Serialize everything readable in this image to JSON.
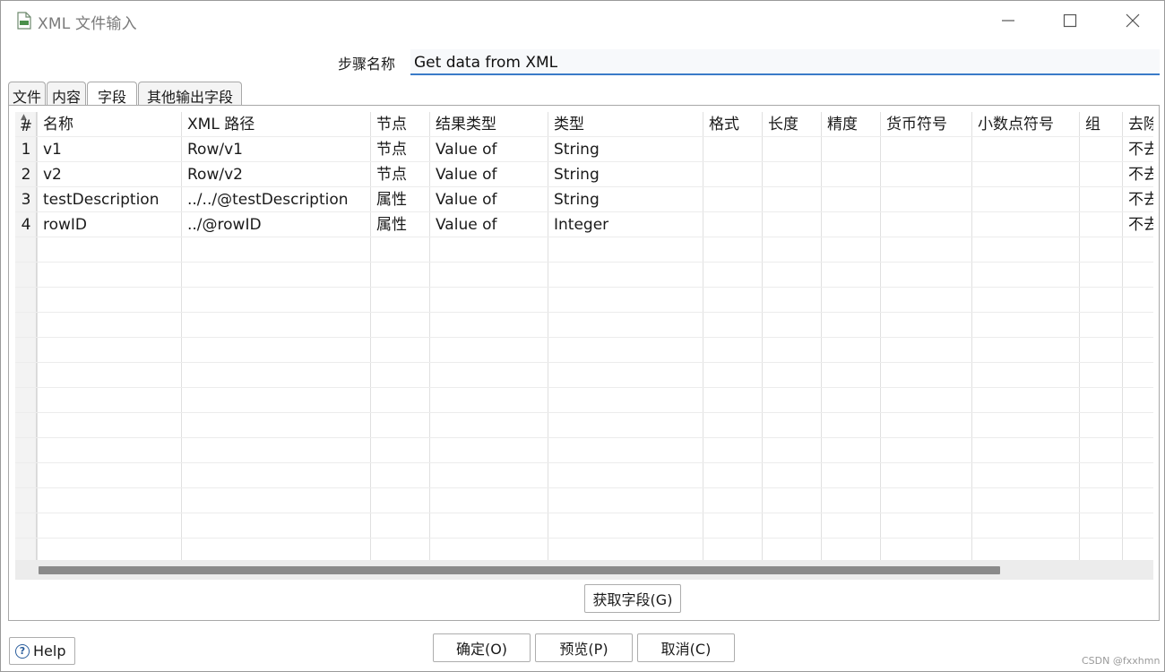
{
  "window": {
    "title": "XML 文件输入",
    "controls": {
      "minimize": "—",
      "maximize": "☐",
      "close": "✕"
    }
  },
  "step": {
    "label": "步骤名称",
    "value": "Get data from XML"
  },
  "tabs": [
    {
      "label": "文件",
      "active": false
    },
    {
      "label": "内容",
      "active": false
    },
    {
      "label": "字段",
      "active": true
    },
    {
      "label": "其他输出字段",
      "active": false
    }
  ],
  "table": {
    "columns": [
      "#",
      "名称",
      "XML 路径",
      "节点",
      "结果类型",
      "类型",
      "格式",
      "长度",
      "精度",
      "货币符号",
      "小数点符号",
      "组",
      "去除空字符"
    ],
    "rows": [
      {
        "num": "1",
        "name": "v1",
        "path": "Row/v1",
        "node": "节点",
        "result": "Value of",
        "type": "String",
        "trim": "不去掉"
      },
      {
        "num": "2",
        "name": "v2",
        "path": "Row/v2",
        "node": "节点",
        "result": "Value of",
        "type": "String",
        "trim": "不去掉"
      },
      {
        "num": "3",
        "name": "testDescription",
        "path": "../../@testDescription",
        "node": "属性",
        "result": "Value of",
        "type": "String",
        "trim": "不去掉"
      },
      {
        "num": "4",
        "name": "rowID",
        "path": "../@rowID",
        "node": "属性",
        "result": "Value of",
        "type": "Integer",
        "trim": "不去掉"
      }
    ]
  },
  "buttons": {
    "get_fields": "获取字段(G)",
    "help": "Help",
    "ok": "确定(O)",
    "preview": "预览(P)",
    "cancel": "取消(C)"
  },
  "watermark": "CSDN @fxxhmn"
}
